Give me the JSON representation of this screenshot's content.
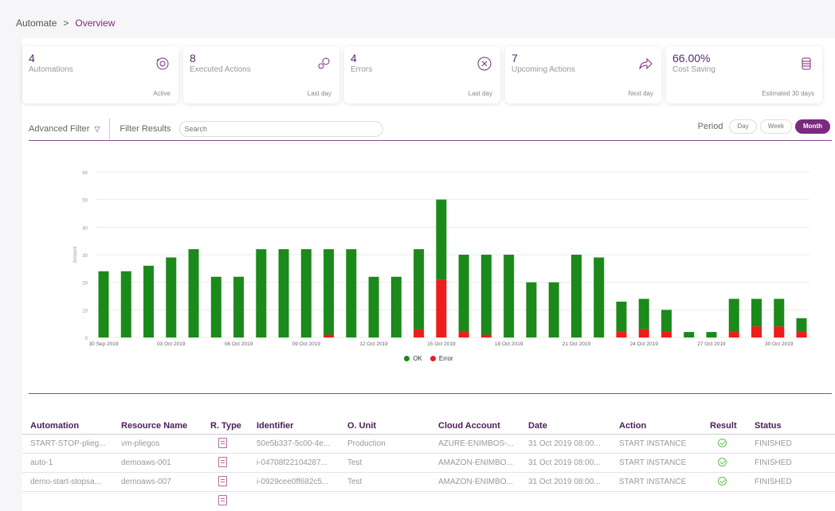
{
  "breadcrumb": {
    "root": "Automate",
    "separator": ">",
    "current": "Overview"
  },
  "cards": [
    {
      "value": "4",
      "label": "Automations",
      "sub": "Active",
      "icon": "automation-gear-icon"
    },
    {
      "value": "8",
      "label": "Executed Actions",
      "sub": "Last day",
      "icon": "gears-icon"
    },
    {
      "value": "4",
      "label": "Errors",
      "sub": "Last day",
      "icon": "error-circle-x-icon"
    },
    {
      "value": "7",
      "label": "Upcoming Actions",
      "sub": "Next day",
      "icon": "share-arrow-icon"
    },
    {
      "value": "66.00%",
      "label": "Cost Saving",
      "sub": "Estimated 30 days",
      "icon": "coins-icon"
    }
  ],
  "filter": {
    "advanced_label": "Advanced Filter",
    "results_label": "Filter Results",
    "search_placeholder": "Search",
    "period_label": "Period",
    "period_options": [
      "Day",
      "Week",
      "Month"
    ],
    "period_selected": "Month"
  },
  "chart_data": {
    "type": "bar",
    "stacked": true,
    "ylabel": "Amount",
    "ylim": [
      0,
      60
    ],
    "yticks": [
      0,
      10,
      20,
      30,
      40,
      50,
      60
    ],
    "xtick_labels": [
      "30 Sep 2019",
      "03 Oct 2019",
      "06 Oct 2019",
      "09 Oct 2019",
      "12 Oct 2019",
      "15 Oct 2019",
      "18 Oct 2019",
      "21 Oct 2019",
      "24 Oct 2019",
      "27 Oct 2019",
      "30 Oct 2019"
    ],
    "series": [
      {
        "name": "OK",
        "color": "#1b8a1b",
        "values": [
          24,
          24,
          26,
          29,
          32,
          22,
          22,
          32,
          32,
          32,
          31,
          32,
          22,
          22,
          29,
          29,
          28,
          29,
          30,
          20,
          20,
          30,
          29,
          11,
          11,
          8,
          2,
          2,
          12,
          10,
          10,
          5
        ]
      },
      {
        "name": "Error",
        "color": "#ee1c1c",
        "values": [
          0,
          0,
          0,
          0,
          0,
          0,
          0,
          0,
          0,
          0,
          1,
          0,
          0,
          0,
          3,
          21,
          2,
          1,
          0,
          0,
          0,
          0,
          0,
          2,
          3,
          2,
          0,
          0,
          2,
          4,
          4,
          2
        ]
      }
    ],
    "legend_position": "bottom"
  },
  "table": {
    "columns": [
      "Automation",
      "Resource Name",
      "R. Type",
      "Identifier",
      "O. Unit",
      "Cloud Account",
      "Date",
      "Action",
      "Result",
      "Status"
    ],
    "rows": [
      [
        "START-STOP-plieg...",
        "vm-pliegos",
        "",
        "50e5b337-5c00-4e...",
        "Production",
        "AZURE-ENIMBOS-...",
        "31 Oct 2019 08:00...",
        "START INSTANCE",
        "",
        "FINISHED"
      ],
      [
        "auto-1",
        "demoaws-001",
        "",
        "i-04708f22104287...",
        "Test",
        "AMAZON-ENIMBO...",
        "31 Oct 2019 08:00...",
        "START INSTANCE",
        "",
        "FINISHED"
      ],
      [
        "demo-start-stopsa...",
        "demoaws-007",
        "",
        "i-0929cee0ff682c5...",
        "Test",
        "AMAZON-ENIMBO...",
        "31 Oct 2019 08:00...",
        "START INSTANCE",
        "",
        "FINISHED"
      ]
    ]
  }
}
